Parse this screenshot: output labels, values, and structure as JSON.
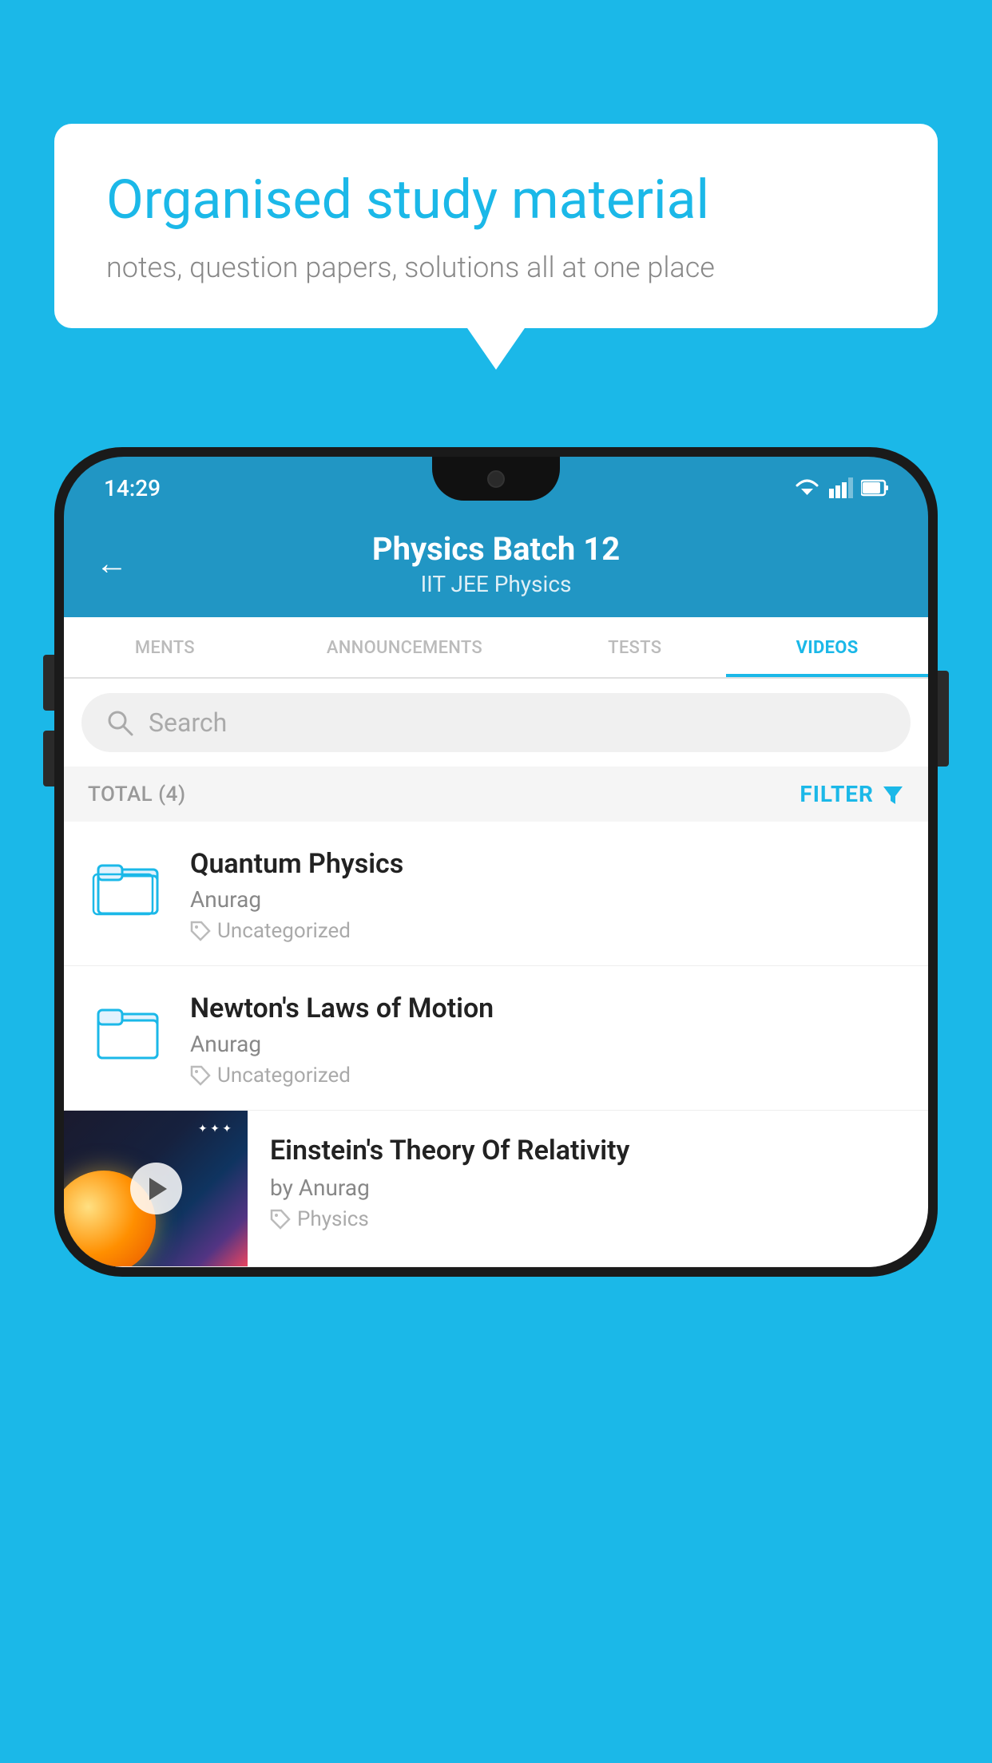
{
  "background_color": "#1BB8E8",
  "speech_bubble": {
    "title": "Organised study material",
    "subtitle": "notes, question papers, solutions all at one place"
  },
  "phone": {
    "status_bar": {
      "time": "14:29",
      "icons": [
        "wifi",
        "signal",
        "battery"
      ]
    },
    "header": {
      "back_label": "←",
      "title": "Physics Batch 12",
      "subtitle": "IIT JEE   Physics"
    },
    "tabs": [
      {
        "label": "MENTS",
        "active": false
      },
      {
        "label": "ANNOUNCEMENTS",
        "active": false
      },
      {
        "label": "TESTS",
        "active": false
      },
      {
        "label": "VIDEOS",
        "active": true
      }
    ],
    "search": {
      "placeholder": "Search"
    },
    "filter_bar": {
      "total_label": "TOTAL (4)",
      "filter_label": "FILTER"
    },
    "videos": [
      {
        "title": "Quantum Physics",
        "author": "Anurag",
        "tag": "Uncategorized",
        "type": "folder"
      },
      {
        "title": "Newton's Laws of Motion",
        "author": "Anurag",
        "tag": "Uncategorized",
        "type": "folder"
      },
      {
        "title": "Einstein's Theory Of Relativity",
        "author": "by Anurag",
        "tag": "Physics",
        "type": "video"
      }
    ]
  }
}
